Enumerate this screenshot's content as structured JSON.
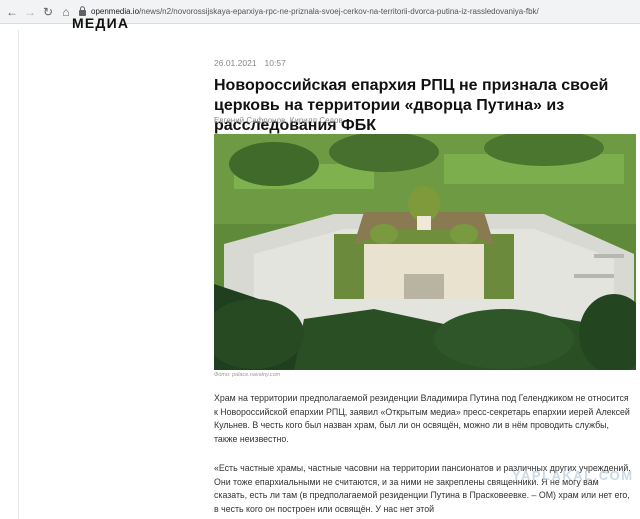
{
  "browser": {
    "back_icon": "←",
    "forward_icon": "→",
    "reload_icon": "↻",
    "home_icon": "⌂",
    "url_domain": "openmedia.io",
    "url_path": "/news/n2/novorossijskaya-eparxiya-rpc-ne-priznala-svoej-cerkov-na-territorii-dvorca-putina-iz-rassledovaniya-fbk/"
  },
  "site": {
    "logo": "МЕДИА"
  },
  "article": {
    "date": "26.01.2021",
    "time": "10:57",
    "title": "Новороссийская епархия РПЦ не признала своей церковь на территории «дворца Путина» из расследования ФБК",
    "authors": "Евгений Сафронов, Кирилл Седов",
    "photo_credit": "Фото: palace.navalny.com",
    "paragraph1": "Храм на территории предполагаемой резиденции Владимира Путина под Геленджиком не относится к Новороссийской епархии РПЦ, заявил «Открытым медиа» пресс-секретарь епархии иерей Алексей Кульнев. В честь кого был назван храм, был ли он освящён, можно ли в нём проводить службы, также неизвестно.",
    "paragraph2": "«Есть частные храмы, частные часовни на территории пансионатов и различных других учреждений. Они тоже епархиальными не считаются, и за ними не закреплены священники. Я не могу вам сказать, есть ли там (в предполагаемой резиденции Путина в Прасковеевке. – ОМ) храм или нет его, в честь кого он построен или освящён. У нас нет этой"
  },
  "watermark": "YAPLAKAL.COM",
  "colors": {
    "background": "#ffffff",
    "browser_bar": "#f1f3f4",
    "text": "#333333",
    "meta": "#888888",
    "watermark": "#b9cedf"
  }
}
